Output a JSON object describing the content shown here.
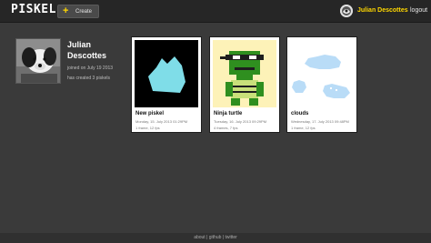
{
  "app": {
    "logo": "PISKEL"
  },
  "toolbar": {
    "create_label": "Create"
  },
  "user": {
    "name": "Julian Descottes",
    "logout_label": "logout"
  },
  "profile": {
    "name": "Julian Descottes",
    "joined": "joined on July 19 2013",
    "created": "has created 3 piskels"
  },
  "piskels": [
    {
      "title": "New piskel",
      "date": "Monday, 15. July 2013 01:29PM",
      "frames": "1 frame, 12 fps"
    },
    {
      "title": "Ninja turtle",
      "date": "Tuesday, 16. July 2013 09:29PM",
      "frames": "4 frames, 7 fps"
    },
    {
      "title": "clouds",
      "date": "Wednesday, 17. July 2013 09:48PM",
      "frames": "1 frame, 12 fps"
    }
  ],
  "footer": {
    "text": "about | github | twitter"
  }
}
